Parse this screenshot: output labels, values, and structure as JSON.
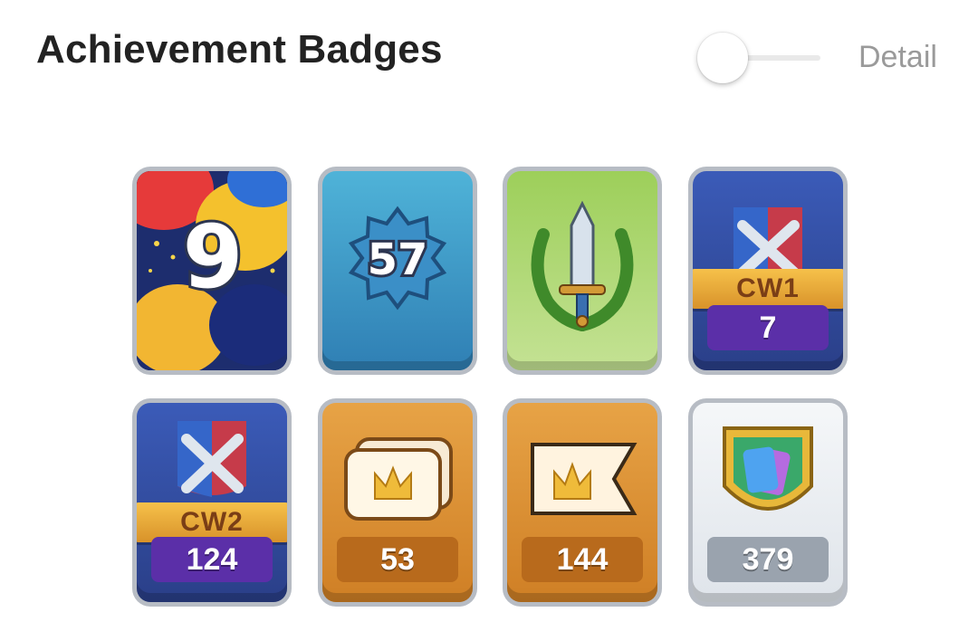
{
  "header": {
    "title": "Achievement Badges",
    "toggle_label": "Detail"
  },
  "badges": [
    {
      "name": "Anniversary",
      "value": "9"
    },
    {
      "name": "Level",
      "value": "57"
    },
    {
      "name": "Sword"
    },
    {
      "name": "Clan War 1",
      "label": "CW1",
      "count": "7"
    },
    {
      "name": "Clan War 2",
      "label": "CW2",
      "count": "124"
    },
    {
      "name": "Crown Card",
      "count": "53"
    },
    {
      "name": "Crown Flag",
      "count": "144"
    },
    {
      "name": "Card Shield",
      "count": "379"
    }
  ],
  "colors": {
    "title": "#222222",
    "toggle_label": "#9a9a9a",
    "purple_plate": "#5b2fa8",
    "orange_plate": "#b86a1c",
    "silver_plate": "#9aa3ae"
  },
  "icons": [
    "balloons-icon",
    "level-star-icon",
    "sword-laurel-icon",
    "crossed-swords-shield-icon",
    "crown-card-icon",
    "crown-flag-icon",
    "cards-shield-icon"
  ]
}
